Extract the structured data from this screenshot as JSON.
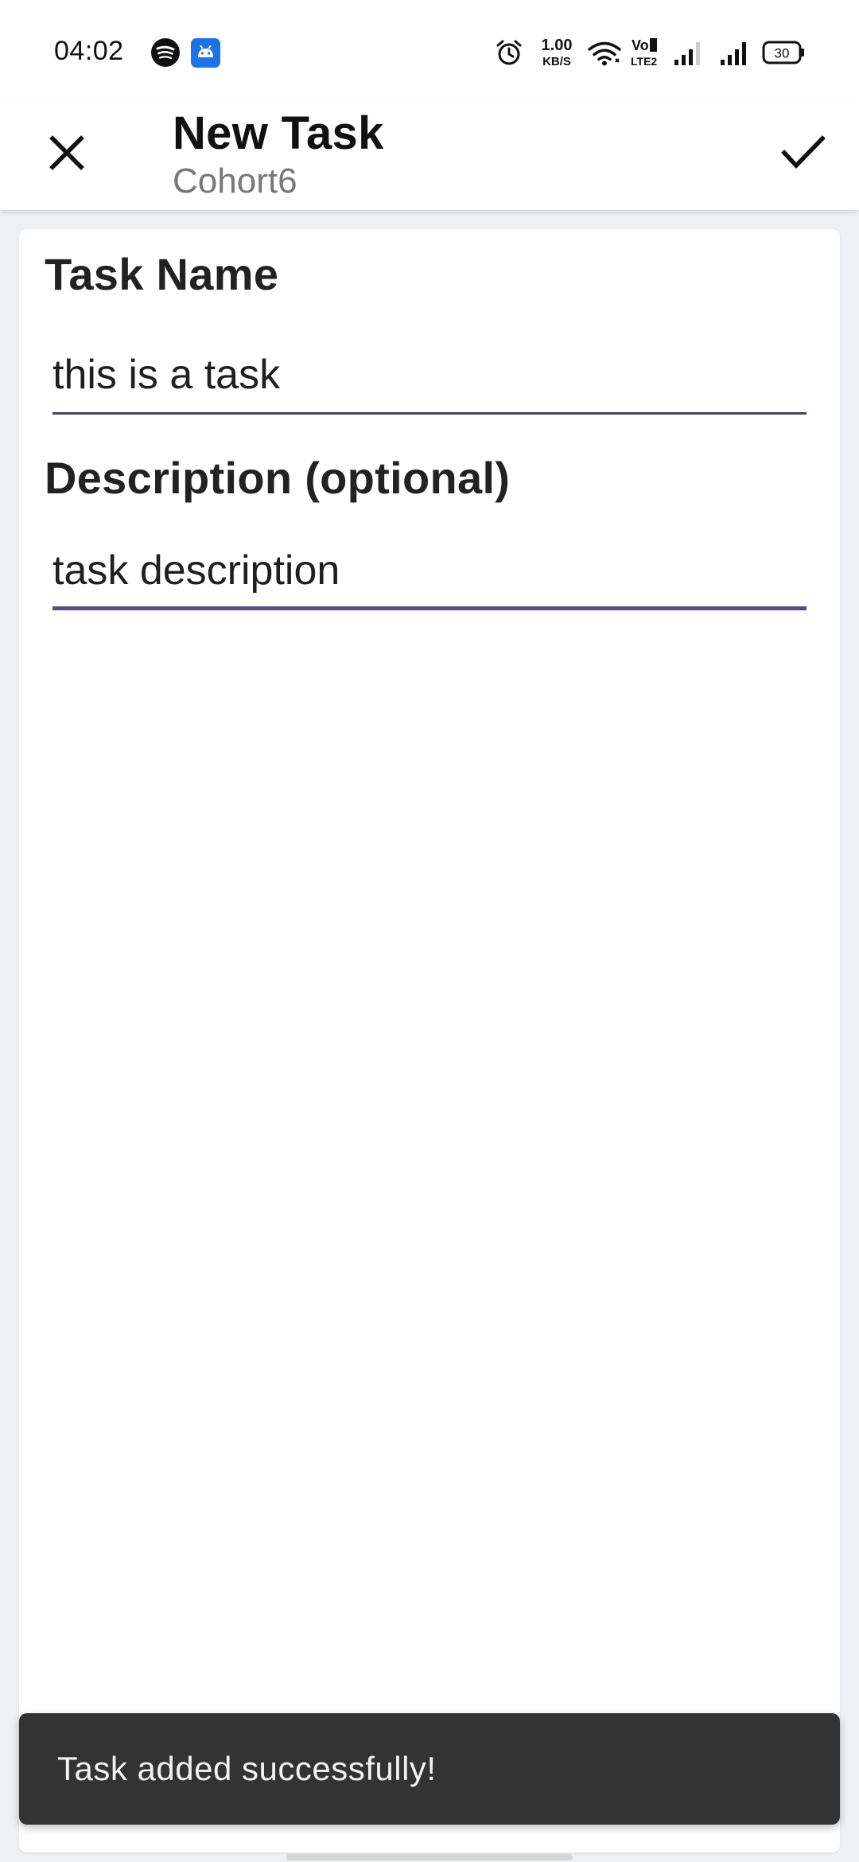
{
  "status_bar": {
    "time": "04:02",
    "network_speed_value": "1.00",
    "network_speed_unit": "KB/S",
    "volte_top": "Vo",
    "volte_bottom": "LTE2",
    "battery": "30",
    "icons": [
      "spotify-icon",
      "android-icon",
      "alarm-icon",
      "wifi-icon",
      "volte-icon",
      "signal-icon",
      "signal-icon",
      "battery-icon"
    ]
  },
  "app_bar": {
    "title": "New Task",
    "subtitle": "Cohort6",
    "close_icon": "close-icon",
    "confirm_icon": "check-icon"
  },
  "form": {
    "task_name_label": "Task Name",
    "task_name_value": "this is a task",
    "description_label": "Description (optional)",
    "description_value": "task description"
  },
  "snackbar": {
    "message": "Task added successfully!"
  },
  "colors": {
    "accent_underline": "#5a4a8a",
    "snackbar_bg": "#333333",
    "background": "#eef0f3"
  }
}
